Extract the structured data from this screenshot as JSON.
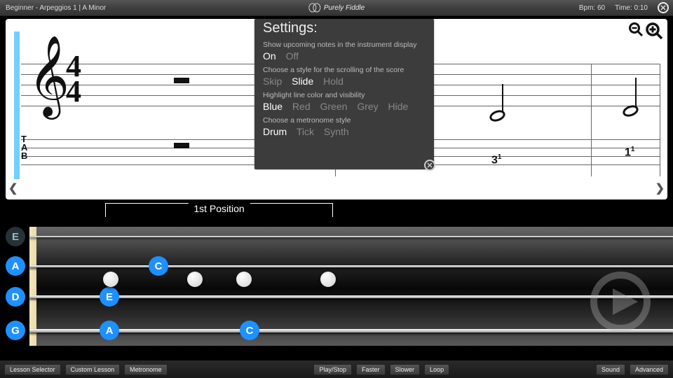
{
  "topbar": {
    "lesson_label": "Beginner - Arpeggios 1  |  A Minor",
    "brand": "Purely Fiddle",
    "bpm_label": "Bpm: 60",
    "time_label": "Time: 0:10"
  },
  "settings_panel": {
    "title": "Settings:",
    "upcoming_desc": "Show upcoming notes in the instrument display",
    "upcoming_opts": {
      "on": "On",
      "off": "Off",
      "selected": "On"
    },
    "scroll_desc": "Choose a style for the scrolling of the score",
    "scroll_opts": {
      "skip": "Skip",
      "slide": "Slide",
      "hold": "Hold",
      "selected": "Slide"
    },
    "highlight_desc": "Highlight line color and visibility",
    "highlight_opts": {
      "blue": "Blue",
      "red": "Red",
      "green": "Green",
      "grey": "Grey",
      "hide": "Hide",
      "selected": "Blue"
    },
    "metronome_desc": "Choose a metronome style",
    "metronome_opts": {
      "drum": "Drum",
      "tick": "Tick",
      "synth": "Synth",
      "selected": "Drum"
    }
  },
  "score": {
    "time_sig_top": "4",
    "time_sig_bottom": "4",
    "tab_letters": {
      "t": "T",
      "a": "A",
      "b": "B"
    },
    "tab_numbers": {
      "n1": "1",
      "n2": "3",
      "n3": "1",
      "finger_sup": "1"
    }
  },
  "instrument": {
    "position_label": "1st Position",
    "open_strings": {
      "E": "E",
      "A": "A",
      "D": "D",
      "G": "G"
    },
    "fret_notes": {
      "C_s2": "C",
      "E_s3": "E",
      "A_s4": "A",
      "C_s4": "C"
    }
  },
  "bottombar": {
    "left": {
      "lesson_selector": "Lesson Selector",
      "custom_lesson": "Custom Lesson",
      "metronome": "Metronome"
    },
    "center": {
      "play_stop": "Play/Stop",
      "faster": "Faster",
      "slower": "Slower",
      "loop": "Loop"
    },
    "right": {
      "sound": "Sound",
      "advanced": "Advanced"
    }
  }
}
